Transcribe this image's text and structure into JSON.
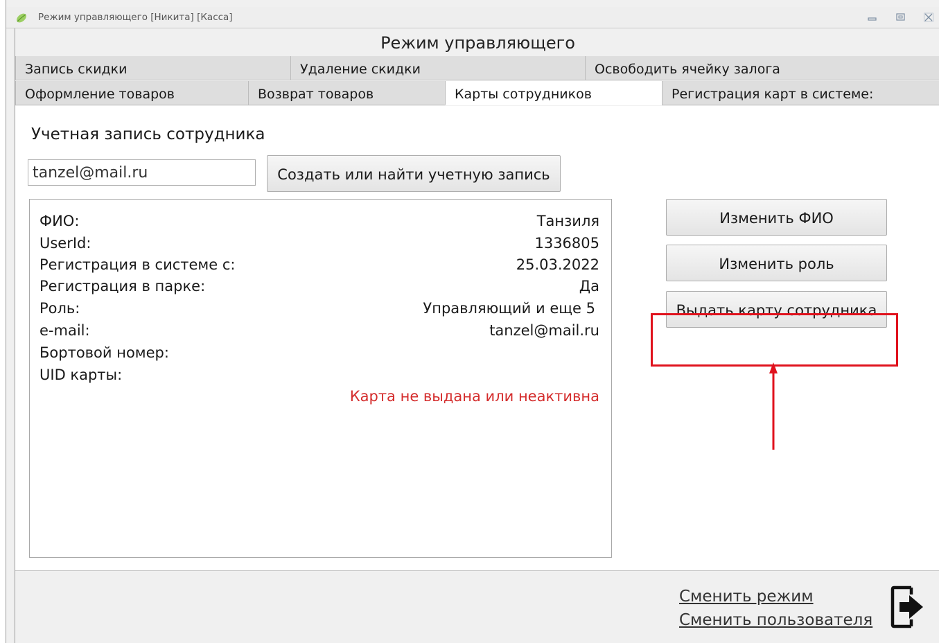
{
  "window": {
    "title": "Режим управляющего [Никита] [Касса]",
    "controls": [
      "minimize-icon",
      "maximize-icon",
      "close-icon"
    ]
  },
  "heading": "Режим управляющего",
  "tabs_row1": [
    {
      "label": "Запись скидки"
    },
    {
      "label": "Удаление скидки"
    },
    {
      "label": "Освободить ячейку залога"
    }
  ],
  "tabs_row2": [
    {
      "label": "Оформление товаров"
    },
    {
      "label": "Возврат товаров"
    },
    {
      "label": "Карты сотрудников",
      "active": true
    },
    {
      "label": "Регистрация карт в системе:"
    }
  ],
  "account": {
    "section_title": "Учетная запись сотрудника",
    "email_value": "tanzel@mail.ru",
    "find_button": "Создать или найти учетную запись"
  },
  "info": {
    "rows": [
      {
        "key": "ФИО:",
        "value": "Танзиля"
      },
      {
        "key": "UserId:",
        "value": "1336805"
      },
      {
        "key": "Регистрация в системе с:",
        "value": "25.03.2022"
      },
      {
        "key": "Регистрация в парке:",
        "value": "Да"
      },
      {
        "key": "Роль:",
        "value": "Управляющий и еще 5"
      },
      {
        "key": "e-mail:",
        "value": "tanzel@mail.ru"
      },
      {
        "key": "Бортовой номер:",
        "value": ""
      },
      {
        "key": "UID карты:",
        "value": ""
      }
    ],
    "card_status": "Карта не выдана или неактивна",
    "card_status_color": "#d42c2c"
  },
  "actions": {
    "change_name": "Изменить ФИО",
    "change_role": "Изменить роль",
    "issue_card": "Выдать карту сотрудника"
  },
  "annotation": {
    "color": "#e0121d"
  },
  "footer": {
    "switch_mode": "Сменить режим",
    "switch_user": "Сменить пользователя",
    "exit_icon": "exit-icon"
  }
}
